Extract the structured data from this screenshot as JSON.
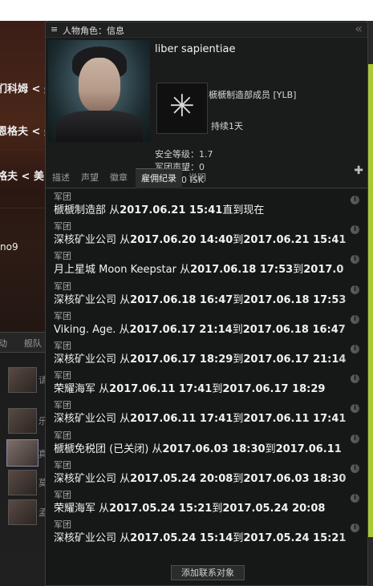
{
  "window": {
    "title": "人物角色：信息",
    "menu_icon": "≡",
    "collapse_icon": "«"
  },
  "background": {
    "names": [
      "扪科姆 < 美",
      "恩格夫 < 美",
      "格夫 < 美"
    ],
    "handle": "no9",
    "tabs": [
      "动",
      "舰队"
    ],
    "list_glyphs": [
      "请",
      "乐",
      "真",
      "莫",
      "孟"
    ]
  },
  "character": {
    "name": "liber sapientiae",
    "corp_title": "榹榹制造部成员 [YLB]",
    "corp_duration": "持续1天",
    "security_status": "安全等级：1.7",
    "corp_standing": "军团声望：0",
    "bounty": "赏金：0 ISK"
  },
  "tabs": [
    {
      "label": "描述",
      "active": false
    },
    {
      "label": "声望",
      "active": false
    },
    {
      "label": "徽章",
      "active": false
    },
    {
      "label": "雇佣纪录",
      "active": true
    },
    {
      "label": "说明",
      "active": false
    }
  ],
  "employment_history": [
    {
      "label": "军团",
      "corp": "榹榹制造部",
      "from_word": " 从",
      "start": "2017.06.21 15:41",
      "to_word": "直到现在",
      "end": ""
    },
    {
      "label": "军团",
      "corp": "深核矿业公司",
      "from_word": " 从",
      "start": "2017.06.20 14:40",
      "to_word": "到",
      "end": "2017.06.21 15:41"
    },
    {
      "label": "军团",
      "corp": "月上星城 Moon Keepstar",
      "from_word": " 从",
      "start": "2017.06.18 17:53",
      "to_word": "到",
      "end": "2017.0"
    },
    {
      "label": "军团",
      "corp": "深核矿业公司",
      "from_word": " 从",
      "start": "2017.06.18 16:47",
      "to_word": "到",
      "end": "2017.06.18 17:53"
    },
    {
      "label": "军团",
      "corp": "Viking. Age.",
      "from_word": " 从",
      "start": "2017.06.17 21:14",
      "to_word": "到",
      "end": "2017.06.18 16:47"
    },
    {
      "label": "军团",
      "corp": "深核矿业公司",
      "from_word": " 从",
      "start": "2017.06.17 18:29",
      "to_word": "到",
      "end": "2017.06.17 21:14"
    },
    {
      "label": "军团",
      "corp": "荣耀海军",
      "from_word": " 从",
      "start": "2017.06.11 17:41",
      "to_word": "到",
      "end": "2017.06.17 18:29"
    },
    {
      "label": "军团",
      "corp": "深核矿业公司",
      "from_word": " 从",
      "start": "2017.06.11 17:41",
      "to_word": "到",
      "end": "2017.06.11 17:41"
    },
    {
      "label": "军团",
      "corp": " 榹榹免税团 (已关闭)",
      "from_word": " 从",
      "start": "2017.06.03 18:30",
      "to_word": "到",
      "end": "2017.06.11"
    },
    {
      "label": "军团",
      "corp": "深核矿业公司",
      "from_word": " 从",
      "start": "2017.05.24 20:08",
      "to_word": "到",
      "end": "2017.06.03 18:30"
    },
    {
      "label": "军团",
      "corp": "荣耀海军",
      "from_word": " 从",
      "start": "2017.05.24 15:21",
      "to_word": "到",
      "end": "2017.05.24 20:08"
    },
    {
      "label": "军团",
      "corp": "深核矿业公司",
      "from_word": " 从",
      "start": "2017.05.24 15:14",
      "to_word": "到",
      "end": "2017.05.24 15:21"
    }
  ],
  "footer": {
    "add_contact_label": "添加联系对象"
  }
}
